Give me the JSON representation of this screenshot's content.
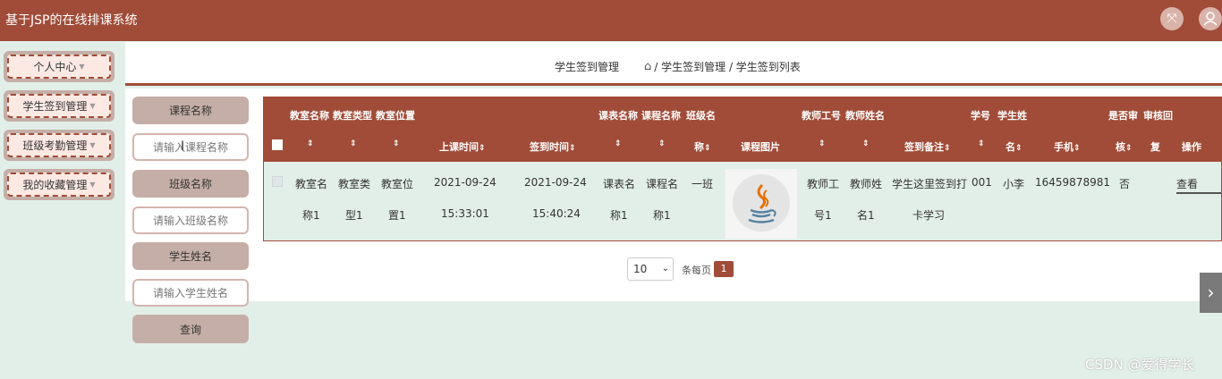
{
  "header": {
    "title": "基于JSP的在线排课系统",
    "fullscreen_icon": "fullscreen-icon",
    "user_icon": "user-icon",
    "bg_color": "#a04c38"
  },
  "sidebar": {
    "items": [
      {
        "label": "个人中心"
      },
      {
        "label": "学生签到管理"
      },
      {
        "label": "班级考勤管理"
      },
      {
        "label": "我的收藏管理"
      }
    ]
  },
  "breadcrumb": {
    "title": "学生签到管理",
    "home_icon": "home-icon",
    "path": "/ 学生签到管理 / 学生签到列表"
  },
  "search": {
    "course_label": "课程名称",
    "course_placeholder": "请输入课程名称",
    "class_label": "班级名称",
    "class_placeholder": "请输入班级名称",
    "student_label": "学生姓名",
    "student_placeholder": "请输入学生姓名",
    "query_label": "查询"
  },
  "table": {
    "headers": {
      "room_name": "教室名称",
      "room_type": "教室类型",
      "room_location": "教室位置",
      "class_time": "上课时间",
      "sign_time": "签到时间",
      "schedule_name": "课表名称",
      "course_name": "课程名称",
      "class_name_a": "班级名",
      "class_name_b": "称",
      "course_image": "课程图片",
      "teacher_id": "教师工号",
      "teacher_name": "教师姓名",
      "sign_note": "签到备注",
      "student_id": "学号",
      "student_name_a": "学生姓",
      "student_name_b": "名",
      "phone": "手机",
      "reviewed_a": "是否审",
      "reviewed_b": "核",
      "review_reply_a": "审核回",
      "review_reply_b": "复",
      "actions": "操作",
      "sort_icon": "⇕"
    },
    "rows": [
      {
        "room_name": [
          "教室名",
          "称1"
        ],
        "room_type": [
          "教室类",
          "型1"
        ],
        "room_location": [
          "教室位",
          "置1"
        ],
        "class_time": [
          "2021-09-24",
          "15:33:01"
        ],
        "sign_time": [
          "2021-09-24",
          "15:40:24"
        ],
        "schedule_name": [
          "课表名",
          "称1"
        ],
        "course_name": [
          "课程名",
          "称1"
        ],
        "class_name": "一班",
        "course_image": "java-logo",
        "teacher_id": [
          "教师工",
          "号1"
        ],
        "teacher_name": [
          "教师姓",
          "名1"
        ],
        "sign_note": [
          "学生这里签到打",
          "卡学习"
        ],
        "student_id": "001",
        "student_name": "小李",
        "phone": "16459878981",
        "reviewed": "否",
        "view_label": "查看"
      }
    ]
  },
  "pagination": {
    "page_size": "10",
    "per_page_label": "条每页",
    "current_page": "1"
  },
  "watermark": "CSDN @爱得学长"
}
